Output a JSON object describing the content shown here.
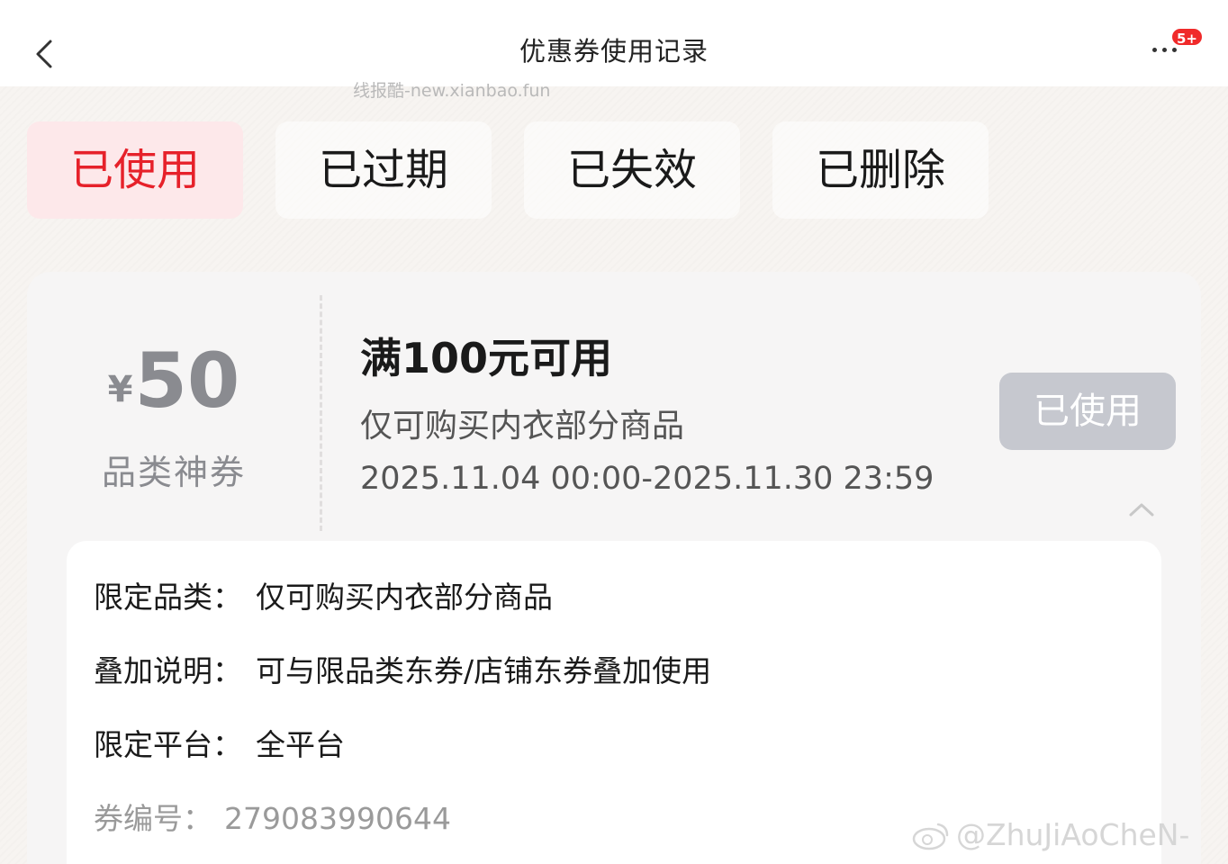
{
  "header": {
    "title": "优惠券使用记录",
    "badge": "5+"
  },
  "watermark": "线报酷-new.xianbao.fun",
  "tabs": [
    {
      "label": "已使用",
      "active": true
    },
    {
      "label": "已过期",
      "active": false
    },
    {
      "label": "已失效",
      "active": false
    },
    {
      "label": "已删除",
      "active": false
    }
  ],
  "coupon": {
    "currency": "¥",
    "amount": "50",
    "kind": "品类神券",
    "condition": "满100元可用",
    "scope": "仅可购买内衣部分商品",
    "validity": "2025.11.04 00:00-2025.11.30 23:59",
    "status_button": "已使用"
  },
  "details": {
    "category_label": "限定品类：",
    "category_value": "仅可购买内衣部分商品",
    "stack_label": "叠加说明：",
    "stack_value": "可与限品类东券/店铺东券叠加使用",
    "platform_label": "限定平台：",
    "platform_value": "全平台",
    "code_label": "券编号：",
    "code_value": "279083990644"
  },
  "weibo_watermark": "@ZhuJiAoCheN-",
  "colors": {
    "accent_red": "#e6212a",
    "active_tab_bg": "#fde8ea",
    "used_button_bg": "#c6c8cf",
    "badge_red": "#f02a2a"
  }
}
